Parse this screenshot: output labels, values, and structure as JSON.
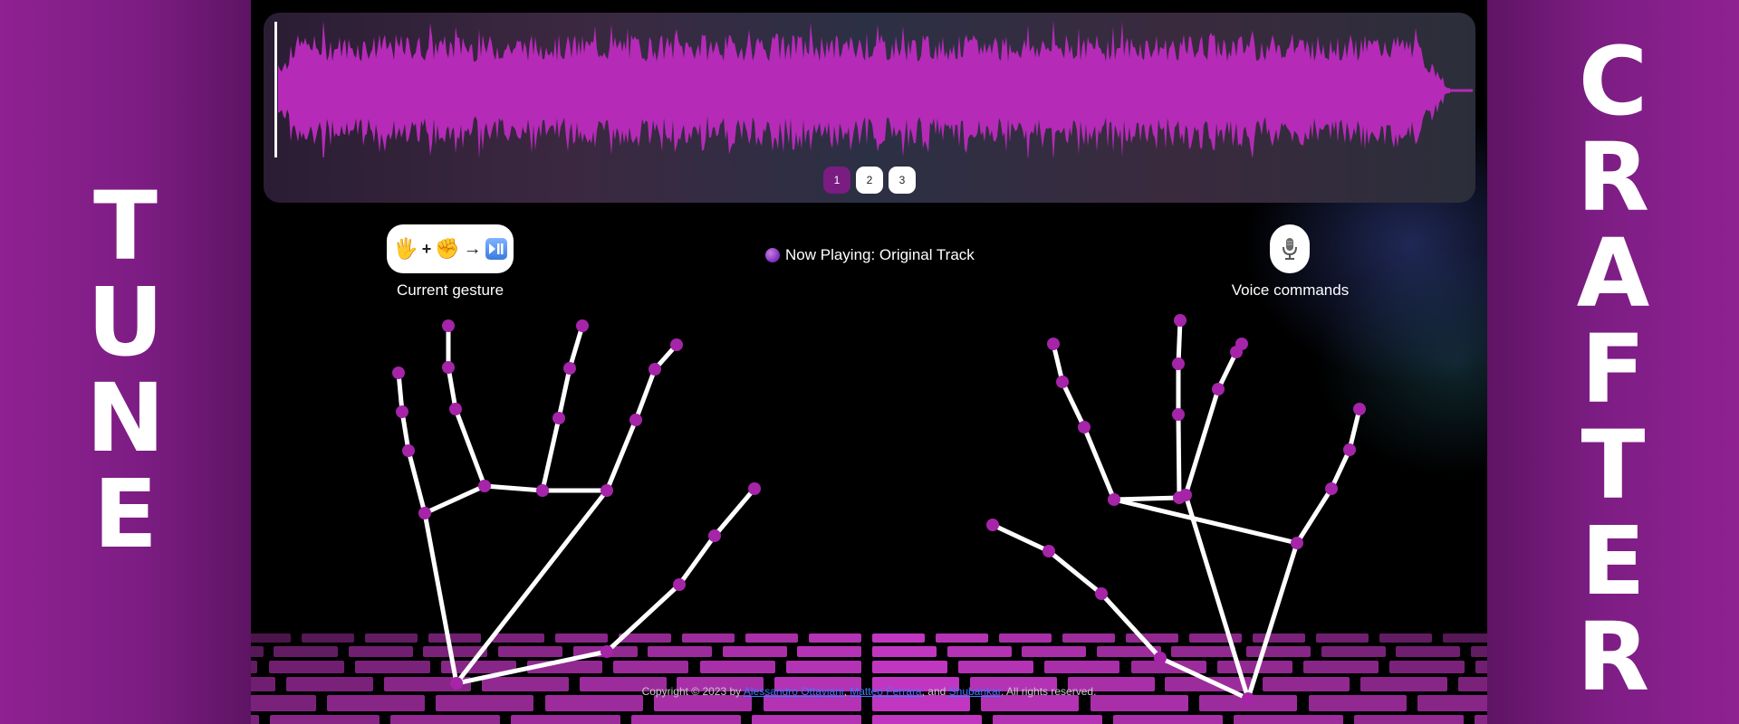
{
  "brand": {
    "left_letters": [
      "T",
      "U",
      "N",
      "E"
    ],
    "right_letters": [
      "C",
      "R",
      "A",
      "F",
      "T",
      "E",
      "R"
    ],
    "accent_color": "#8f2191"
  },
  "waveform": {
    "color": "#b62ab8",
    "pages": [
      {
        "label": "1",
        "active": true
      },
      {
        "label": "2",
        "active": false
      },
      {
        "label": "3",
        "active": false
      }
    ]
  },
  "gesture": {
    "icons": [
      "raised-hand-icon",
      "plus",
      "raised-fist-icon",
      "arrow-right-icon",
      "play-pause-icon"
    ],
    "symbols": {
      "hand": "🖐️",
      "plus": "+",
      "fist": "✊",
      "arrow": "→",
      "playpause": "⏯"
    },
    "caption": "Current gesture"
  },
  "now_playing": {
    "label": "Now Playing: Original Track"
  },
  "voice": {
    "icon": "microphone-icon",
    "caption": "Voice commands"
  },
  "footer": {
    "prefix": "Copyright © 2023 by ",
    "author1": "Alessandro Ottaviani",
    "sep1": ", ",
    "author2": "Matteo Ferrara",
    "sep2": ", and ",
    "author3": "Shubankar",
    "suffix": ". All rights reserved."
  }
}
